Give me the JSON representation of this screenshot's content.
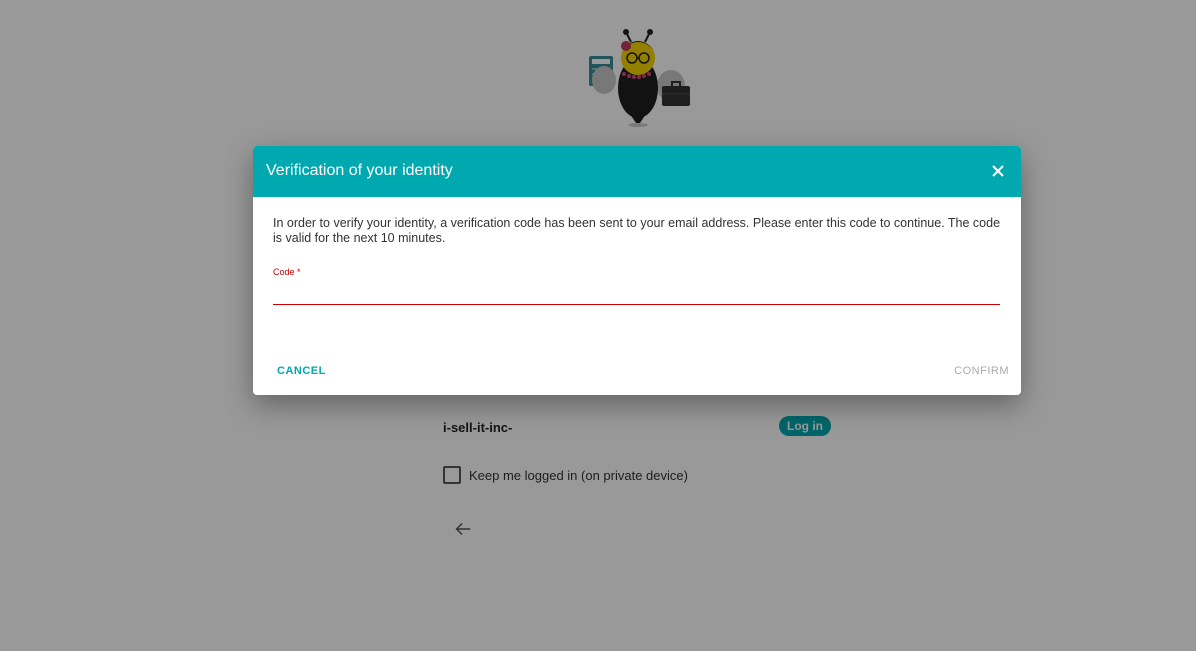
{
  "background": {
    "account_name": "i-sell-it-inc-",
    "login_button": "Log in",
    "keep_logged_in_label": "Keep me logged in (on private device)",
    "keep_logged_in_checked": false
  },
  "dialog": {
    "title": "Verification of your identity",
    "message": "In order to verify your identity, a verification code has been sent to your email address. Please enter this code to continue. The code is valid for the next 10 minutes.",
    "code_field": {
      "label": "Code *",
      "value": "",
      "placeholder": ""
    },
    "cancel_label": "CANCEL",
    "confirm_label": "CONFIRM"
  },
  "colors": {
    "accent": "#00a9b0",
    "error": "#cc0000",
    "disabled": "#aaaaaa"
  },
  "icons": [
    "bee-mascot-icon",
    "close-icon",
    "back-arrow-icon"
  ]
}
